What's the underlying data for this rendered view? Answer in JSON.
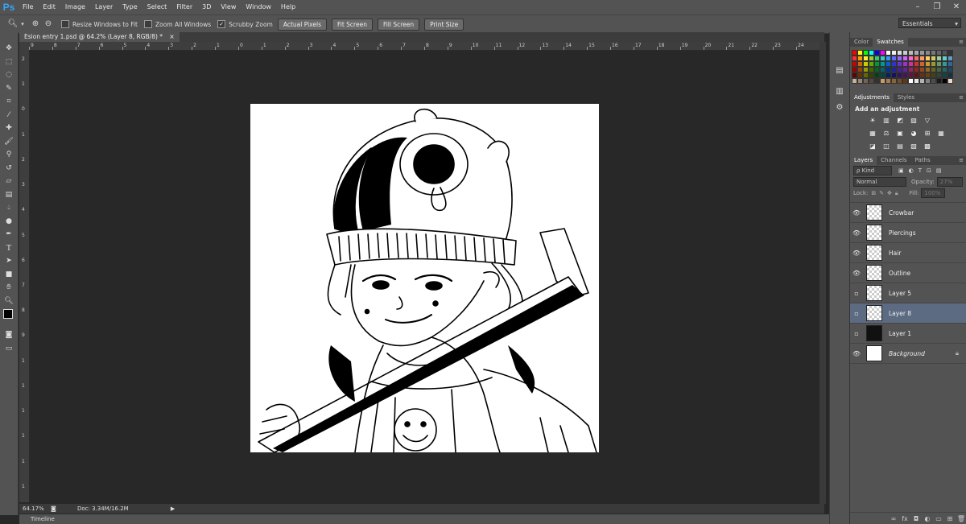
{
  "app": {
    "logo": "Ps"
  },
  "menu": [
    "File",
    "Edit",
    "Image",
    "Layer",
    "Type",
    "Select",
    "Filter",
    "3D",
    "View",
    "Window",
    "Help"
  ],
  "window_controls": [
    "–",
    "❐",
    "✕"
  ],
  "options": {
    "checks": [
      {
        "label": "Resize Windows to Fit",
        "checked": false
      },
      {
        "label": "Zoom All Windows",
        "checked": false
      },
      {
        "label": "Scrubby Zoom",
        "checked": true
      }
    ],
    "buttons": [
      "Actual Pixels",
      "Fit Screen",
      "Fill Screen",
      "Print Size"
    ],
    "workspace": "Essentials"
  },
  "document": {
    "tab_title": "Esion entry 1.psd @ 64.2% (Layer 8, RGB/8) *",
    "close": "×"
  },
  "ruler_h": [
    "9",
    "8",
    "7",
    "6",
    "5",
    "4",
    "3",
    "2",
    "1",
    "0",
    "1",
    "2",
    "3",
    "4",
    "5",
    "6",
    "7",
    "8",
    "9",
    "10",
    "11",
    "12",
    "13",
    "14",
    "15",
    "16",
    "17",
    "18",
    "19",
    "20",
    "21",
    "22",
    "23",
    "24"
  ],
  "ruler_v": [
    "2",
    "1",
    "0",
    "1",
    "2",
    "3",
    "4",
    "5",
    "6",
    "7",
    "8",
    "9",
    "1",
    "1",
    "1",
    "1",
    "1",
    "1"
  ],
  "status": {
    "zoom": "64.17%",
    "doc": "Doc: 3.34M/16.2M",
    "arrow": "▶"
  },
  "timeline": {
    "label": "Timeline"
  },
  "panels": {
    "color_tabs": [
      "Color",
      "Swatches"
    ],
    "swatch_colors": [
      "#ff0000",
      "#ffff00",
      "#00ff00",
      "#00ffff",
      "#0000ff",
      "#ff00ff",
      "#ffffff",
      "#eeeeee",
      "#dddddd",
      "#cccccc",
      "#bbbbbb",
      "#aaaaaa",
      "#999999",
      "#888888",
      "#777777",
      "#666666",
      "#555555",
      "#333333",
      "#ff3030",
      "#ff9900",
      "#ffee33",
      "#99cc33",
      "#33cc66",
      "#33cccc",
      "#3399ff",
      "#6666ff",
      "#9966ff",
      "#cc66ff",
      "#ff66cc",
      "#ff6666",
      "#ff9966",
      "#ffcc66",
      "#cccc66",
      "#99cc99",
      "#66cccc",
      "#6699cc",
      "#cc0000",
      "#cc6600",
      "#cccc00",
      "#66aa00",
      "#009933",
      "#009999",
      "#0066cc",
      "#3333cc",
      "#6633cc",
      "#9933cc",
      "#cc3399",
      "#cc3333",
      "#cc6633",
      "#cc9933",
      "#999933",
      "#669966",
      "#339999",
      "#336699",
      "#990000",
      "#994400",
      "#999900",
      "#446600",
      "#006622",
      "#006666",
      "#003399",
      "#222299",
      "#442299",
      "#662299",
      "#992266",
      "#992222",
      "#994422",
      "#996622",
      "#666622",
      "#446644",
      "#226666",
      "#224466",
      "#660000",
      "#663300",
      "#666600",
      "#334400",
      "#004411",
      "#004444",
      "#002266",
      "#111166",
      "#331166",
      "#441166",
      "#661144",
      "#661111",
      "#663311",
      "#664411",
      "#444411",
      "#334433",
      "#114444",
      "#113344",
      "#c7b299",
      "#998675",
      "#736357",
      "#534741",
      "#37302d",
      "#c69c6d",
      "#a67c52",
      "#8c6239",
      "#754c24",
      "#603913",
      "#ffffff",
      "#e6e6e6",
      "#b3b3b3",
      "#808080",
      "#4d4d4d",
      "#1a1a1a",
      "#000000",
      "#f2d7c9"
    ],
    "adjust_tabs": [
      "Adjustments",
      "Styles"
    ],
    "adjust_title": "Add an adjustment",
    "adjust_row1": [
      "☀",
      "▥",
      "◩",
      "▨",
      "▽"
    ],
    "adjust_row2": [
      "▦",
      "⚖",
      "▣",
      "◕",
      "⊞",
      "▦"
    ],
    "adjust_row3": [
      "◪",
      "◫",
      "▤",
      "▧",
      "▩"
    ],
    "layers_tabs": [
      "Layers",
      "Channels",
      "Paths"
    ],
    "kind": "ρ Kind",
    "blend": "Normal",
    "opacity_label": "Opacity:",
    "opacity": "27%",
    "lock_label": "Lock:",
    "fill_label": "Fill:",
    "fill": "100%",
    "layers": [
      {
        "name": "Crowbar",
        "visible": true,
        "thumb": "trans",
        "selected": false,
        "italic": false
      },
      {
        "name": "Piercings",
        "visible": true,
        "thumb": "trans",
        "selected": false,
        "italic": false
      },
      {
        "name": "Hair",
        "visible": true,
        "thumb": "trans",
        "selected": false,
        "italic": false
      },
      {
        "name": "Outline",
        "visible": true,
        "thumb": "trans",
        "selected": false,
        "italic": false
      },
      {
        "name": "Layer 5",
        "visible": false,
        "thumb": "trans",
        "selected": false,
        "italic": false
      },
      {
        "name": "Layer 8",
        "visible": false,
        "thumb": "trans",
        "selected": true,
        "italic": false
      },
      {
        "name": "Layer 1",
        "visible": false,
        "thumb": "dark",
        "selected": false,
        "italic": false
      },
      {
        "name": "Background",
        "visible": true,
        "thumb": "white",
        "selected": false,
        "italic": true
      }
    ]
  }
}
